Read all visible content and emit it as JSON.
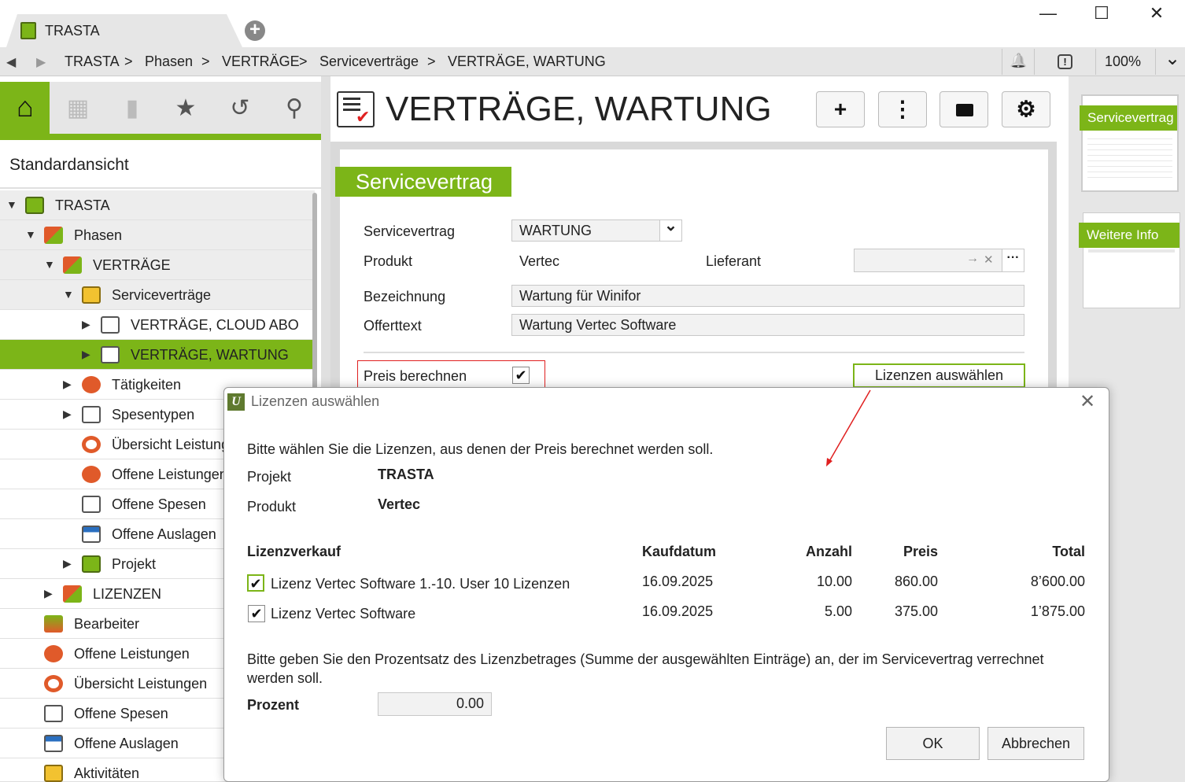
{
  "window": {
    "tab_label": "TRASTA",
    "new_tab_icon": "plus-icon",
    "minimize": "—",
    "maximize": "☐",
    "close": "✕"
  },
  "navbar": {
    "back": "◀",
    "forward": "▶",
    "crumbs": [
      "TRASTA",
      ">",
      "Phasen",
      ">",
      "VERTRÄGE",
      ">",
      "Serviceverträge",
      ">",
      "VERTRÄGE, WARTUNG"
    ],
    "bell_icon": "🔔",
    "alert_icon": "!",
    "zoom": "100%",
    "zoom_chevron": "⌄"
  },
  "toolbar": {
    "home_icon": "⌂",
    "calendar_icon": "▦",
    "chart_icon": "▮",
    "star_icon": "★",
    "history_icon": "↺",
    "search_icon": "⚲"
  },
  "sidebar": {
    "view_title": "Standardansicht",
    "items": [
      {
        "label": "TRASTA",
        "arrow": "▼"
      },
      {
        "label": "Phasen",
        "arrow": "▼"
      },
      {
        "label": "VERTRÄGE",
        "arrow": "▼"
      },
      {
        "label": "Serviceverträge",
        "arrow": "▼"
      },
      {
        "label": "VERTRÄGE, CLOUD ABO",
        "arrow": "▶"
      },
      {
        "label": "VERTRÄGE, WARTUNG",
        "arrow": "▶"
      },
      {
        "label": "Tätigkeiten",
        "arrow": "▶"
      },
      {
        "label": "Spesentypen",
        "arrow": "▶"
      },
      {
        "label": "Übersicht Leistung",
        "arrow": ""
      },
      {
        "label": "Offene Leistungen",
        "arrow": ""
      },
      {
        "label": "Offene Spesen",
        "arrow": ""
      },
      {
        "label": "Offene Auslagen",
        "arrow": ""
      },
      {
        "label": "Projekt",
        "arrow": "▶"
      },
      {
        "label": "LIZENZEN",
        "arrow": "▶"
      },
      {
        "label": "Bearbeiter",
        "arrow": ""
      },
      {
        "label": "Offene Leistungen",
        "arrow": ""
      },
      {
        "label": "Übersicht Leistungen",
        "arrow": ""
      },
      {
        "label": "Offene Spesen",
        "arrow": ""
      },
      {
        "label": "Offene Auslagen",
        "arrow": ""
      },
      {
        "label": "Aktivitäten",
        "arrow": ""
      }
    ]
  },
  "main": {
    "title": "VERTRÄGE, WARTUNG",
    "actions": {
      "add": "+",
      "more": "⋮",
      "folder": "▬",
      "settings": "⚙"
    },
    "form": {
      "header": "Servicevertrag",
      "servicevertrag_label": "Servicevertrag",
      "servicevertrag_value": "WARTUNG",
      "dropdown_chevron": "⌄",
      "produkt_label": "Produkt",
      "produkt_value": "Vertec",
      "lieferant_label": "Lieferant",
      "lieferant_value": "",
      "lieferant_arrow": "→",
      "lieferant_clear": "✕",
      "lieferant_more": "···",
      "bezeichnung_label": "Bezeichnung",
      "bezeichnung_value": "Wartung für Winifor",
      "offerttext_label": "Offerttext",
      "offerttext_value": "Wartung Vertec Software",
      "preis_label": "Preis berechnen",
      "preis_checked": "✔",
      "lizenzen_button": "Lizenzen auswählen"
    }
  },
  "rightpanel": {
    "thumb1": "Servicevertrag",
    "thumb2": "Weitere Info"
  },
  "dialog": {
    "title": "Lizenzen auswählen",
    "app_icon": "U",
    "close": "✕",
    "intro": "Bitte wählen Sie die Lizenzen, aus denen der Preis berechnet werden soll.",
    "projekt_label": "Projekt",
    "projekt_value": "TRASTA",
    "produkt_label": "Produkt",
    "produkt_value": "Vertec",
    "columns": {
      "lizenz": "Lizenzverkauf",
      "datum": "Kaufdatum",
      "anzahl": "Anzahl",
      "preis": "Preis",
      "total": "Total"
    },
    "rows": [
      {
        "checked": "✔",
        "name": "Lizenz Vertec Software 1.-10. User 10 Lizenzen",
        "datum": "16.09.2025",
        "anzahl": "10.00",
        "preis": "860.00",
        "total": "8’600.00"
      },
      {
        "checked": "✔",
        "name": "Lizenz Vertec Software",
        "datum": "16.09.2025",
        "anzahl": "5.00",
        "preis": "375.00",
        "total": "1’875.00"
      }
    ],
    "prozent_hint": "Bitte geben Sie den Prozentsatz des Lizenzbetrages (Summe der ausgewählten Einträge) an, der im Servicevertrag verrechnet werden soll.",
    "prozent_label": "Prozent",
    "prozent_value": "0.00",
    "ok": "OK",
    "cancel": "Abbrechen"
  },
  "colors": {
    "accent": "#7cb518",
    "annotation": "#e02020"
  }
}
